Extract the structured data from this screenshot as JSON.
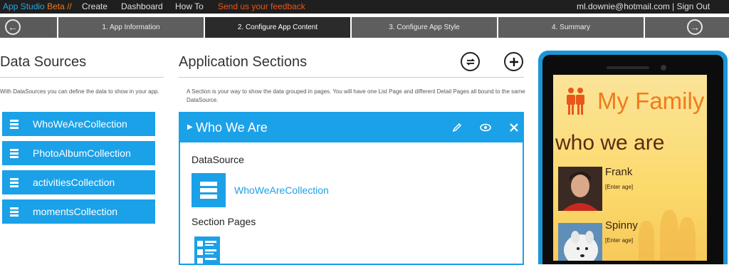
{
  "topbar": {
    "brand": "App Studio",
    "beta": "Beta //",
    "nav": [
      "Create",
      "Dashboard",
      "How To"
    ],
    "feedback": "Send us your feedback",
    "user_email": "ml.downie@hotmail.com",
    "sign_out": "| Sign Out"
  },
  "steps": {
    "items": [
      "1. App Information",
      "2. Configure App Content",
      "3. Configure App Style",
      "4. Summary"
    ],
    "active_index": 1
  },
  "data_sources": {
    "title": "Data Sources",
    "description": "With DataSources you can define the data to show in your app.",
    "items": [
      "WhoWeAreCollection",
      "PhotoAlbumCollection",
      "activitiesCollection",
      "momentsCollection"
    ]
  },
  "app_sections": {
    "title": "Application Sections",
    "description": "A Section is your way to show the data grouped in pages. You will have one List Page and different Detail Pages all bound to the same DataSource.",
    "section": {
      "title": "Who We Are",
      "datasource_label": "DataSource",
      "datasource_value": "WhoWeAreCollection",
      "pages_label": "Section Pages"
    }
  },
  "phone_preview": {
    "app_title": "My Family",
    "section_title": "who we are",
    "people": [
      {
        "name": "Frank",
        "age": "[Enter age]"
      },
      {
        "name": "Spinny",
        "age": "[Enter age]"
      }
    ]
  },
  "colors": {
    "accent": "#1ba1e8",
    "orange": "#f07b1d",
    "topbar": "#1f1f1f"
  }
}
